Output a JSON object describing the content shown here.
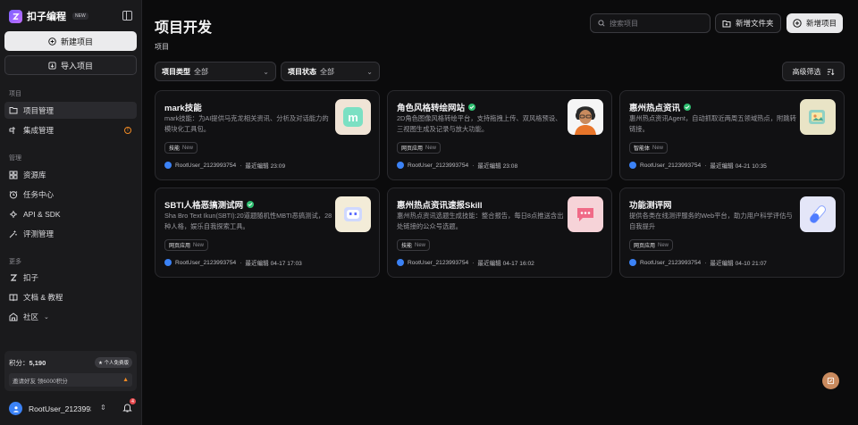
{
  "brand": {
    "name": "扣子编程",
    "badge": "NEW"
  },
  "sidebar": {
    "new_project": "新建项目",
    "import_project": "导入项目",
    "section_project": "项目",
    "nav_projects": "项目管理",
    "nav_integrations": "集成管理",
    "section_manage": "管理",
    "nav_resources": "资源库",
    "nav_tasks": "任务中心",
    "nav_api": "API & SDK",
    "nav_eval": "评测管理",
    "section_more": "更多",
    "nav_kouzi": "扣子",
    "nav_docs": "文档 & 教程",
    "nav_community": "社区"
  },
  "points": {
    "label": "积分：",
    "value": "5,190",
    "badge": "个人免费版",
    "invite": "邀请好友 领6000积分"
  },
  "user": {
    "name": "RootUser_2123993754",
    "notification_count": "4"
  },
  "main": {
    "title": "项目开发",
    "section": "项目",
    "search_placeholder": "搜索项目",
    "new_folder": "新增文件夹",
    "new_project": "新增项目",
    "filter_type_label": "项目类型",
    "filter_type_value": "全部",
    "filter_status_label": "项目状态",
    "filter_status_value": "全部",
    "advanced_filter": "高级筛选"
  },
  "cards": [
    {
      "title": "mark技能",
      "verified": false,
      "desc": "mark技能：为AI提供马克龙相关资讯、分析及对话能力的模块化工具包。",
      "tag": "技能",
      "tag_new": "New",
      "owner": "RootUser_2123993754",
      "edited": "最近编辑 23:09"
    },
    {
      "title": "角色风格转绘网站",
      "verified": true,
      "desc": "2D角色图像风格转绘平台，支持拖拽上传、双风格预设、三视图生成及记录与放大功能。",
      "tag": "网页应用",
      "tag_new": "New",
      "owner": "RootUser_2123993754",
      "edited": "最近编辑 23:08"
    },
    {
      "title": "惠州热点资讯",
      "verified": true,
      "desc": "惠州热点资讯Agent，自动抓取近两周五领域热点，附跳转链接。",
      "tag": "智能体",
      "tag_new": "New",
      "owner": "RootUser_2123993754",
      "edited": "最近编辑 04-21 10:35"
    },
    {
      "title": "SBTI人格恶搞测试网",
      "verified": true,
      "desc": "Sha Bro Text Ikun(SBTI):20道题随机性MBTI恶搞测试，28种人格，娱乐自我探索工具。",
      "tag": "网页应用",
      "tag_new": "New",
      "owner": "RootUser_2123993754",
      "edited": "最近编辑 04-17 17:03"
    },
    {
      "title": "惠州热点资讯速报Skill",
      "verified": false,
      "desc": "惠州热点资讯选题生成技能：整合报告，每日8点推送含出处链接的公众号选题。",
      "tag": "技能",
      "tag_new": "New",
      "owner": "RootUser_2123993754",
      "edited": "最近编辑 04-17 16:02"
    },
    {
      "title": "功能测评网",
      "verified": false,
      "desc": "提供各类在线测评服务的Web平台，助力用户科学评估与自我提升",
      "tag": "网页应用",
      "tag_new": "New",
      "owner": "RootUser_2123993754",
      "edited": "最近编辑 04-10 21:07"
    }
  ]
}
